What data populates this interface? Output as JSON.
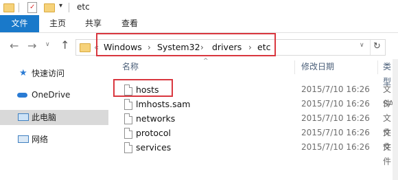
{
  "title": "etc",
  "ribbon": {
    "file": "文件",
    "tabs": [
      "主页",
      "共享",
      "查看"
    ]
  },
  "address": {
    "crumbs": [
      "Windows",
      "System32",
      "drivers",
      "etc"
    ],
    "separator": "›",
    "refresh_icon": "refresh-icon"
  },
  "sidebar": {
    "items": [
      {
        "label": "快速访问",
        "icon": "star-icon"
      },
      {
        "label": "OneDrive",
        "icon": "cloud-icon"
      },
      {
        "label": "此电脑",
        "icon": "computer-icon",
        "selected": true
      },
      {
        "label": "网络",
        "icon": "network-icon"
      }
    ]
  },
  "list": {
    "headers": {
      "name": "名称",
      "date": "修改日期",
      "type": "类型"
    },
    "rows": [
      {
        "name": "hosts",
        "date": "2015/7/10 16:26",
        "type": "文件"
      },
      {
        "name": "lmhosts.sam",
        "date": "2015/7/10 16:26",
        "type": "SAM"
      },
      {
        "name": "networks",
        "date": "2015/7/10 16:26",
        "type": "文件"
      },
      {
        "name": "protocol",
        "date": "2015/7/10 16:26",
        "type": "文件"
      },
      {
        "name": "services",
        "date": "2015/7/10 16:26",
        "type": "文件"
      }
    ]
  },
  "colors": {
    "accent": "#1979ca",
    "highlight": "#d9363e",
    "selected": "#d9d9d9"
  }
}
